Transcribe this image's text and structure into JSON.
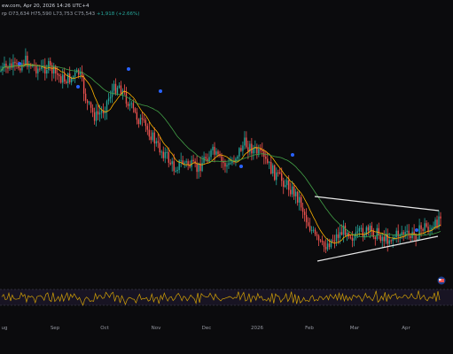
{
  "header": {
    "line1": "ew.com, Apr 20, 2026 14:26 UTC+4",
    "line2_prefix": "rp",
    "open": "O73,634",
    "high": "H75,590",
    "low": "L73,753",
    "close": "C75,543",
    "change": "+1,918 (+2.66%)"
  },
  "colors": {
    "background": "#0b0b0d",
    "bull": "#26a69a",
    "bear": "#ef5350",
    "ma_fast": "#ffb300",
    "ma_slow": "#43a047",
    "trendline": "#e8e8e8",
    "signal": "#2962ff",
    "oscillator": "#d2a106",
    "osc_band": "#7e57c2"
  },
  "chart_data": {
    "type": "candlestick",
    "x_axis": {
      "ticks": [
        "ug",
        "Sep",
        "Oct",
        "Nov",
        "Dec",
        "2026",
        "Feb",
        "Mar",
        "Apr"
      ]
    },
    "price_path": [
      80,
      75,
      77,
      68,
      74,
      79,
      75,
      84,
      90,
      88,
      82,
      118,
      132,
      125,
      105,
      95,
      112,
      128,
      140,
      150,
      166,
      175,
      190,
      183,
      186,
      192,
      178,
      172,
      183,
      188,
      175,
      162,
      168,
      175,
      186,
      198,
      205,
      214,
      225,
      250,
      268,
      280,
      272,
      265,
      258,
      270,
      262,
      262,
      264,
      270,
      268,
      262,
      268,
      264,
      255,
      262,
      240
    ],
    "pattern": {
      "type": "triangle",
      "upper_line": "resistance from Feb high to Apr",
      "lower_line": "support from Feb low to Apr"
    },
    "oscillator": {
      "name": "",
      "band_upper": 70,
      "band_lower": 30
    },
    "legend": "none",
    "grid": false
  },
  "badge": {
    "icon": "flag-badge-icon"
  }
}
